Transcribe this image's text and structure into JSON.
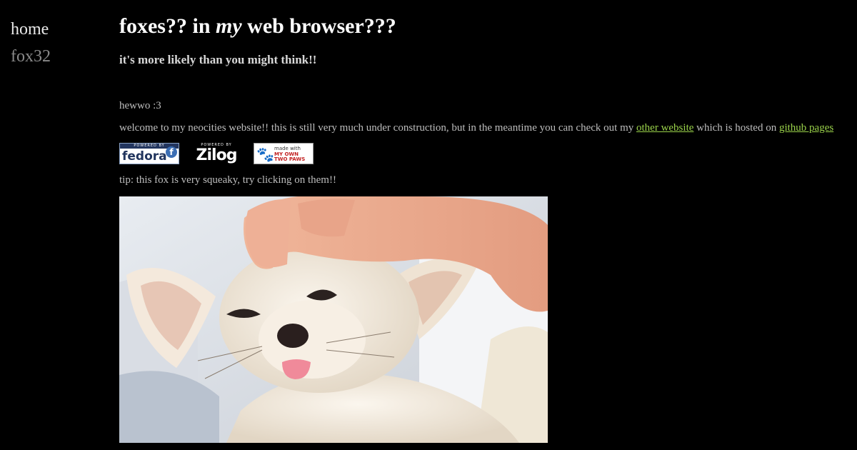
{
  "sidebar": {
    "items": [
      {
        "label": "home"
      },
      {
        "label": "fox32"
      }
    ]
  },
  "main": {
    "title_pre": "foxes?? in ",
    "title_em": "my",
    "title_post": " web browser???",
    "subtitle": "it's more likely than you might think!!",
    "greeting": "hewwo :3",
    "welcome_pre": "welcome to my neocities website!! this is still very much under construction, but in the meantime you can check out my ",
    "other_link": "other website",
    "welcome_mid": " which is hosted on ",
    "github_link": "github pages",
    "tip": "tip: this fox is very squeaky, try clicking on them!!"
  },
  "badges": {
    "fedora": {
      "top": "POWERED BY",
      "word": "fedora",
      "logo": "f"
    },
    "zilog": {
      "top": "POWERED BY",
      "word": "Zilog"
    },
    "paws": {
      "line1": "made with",
      "line2": "MY OWN",
      "line3": "TWO PAWS",
      "icon": "paw-icon"
    }
  },
  "colors": {
    "background": "#000000",
    "link": "#9ad24a",
    "title": "#ffffff"
  }
}
